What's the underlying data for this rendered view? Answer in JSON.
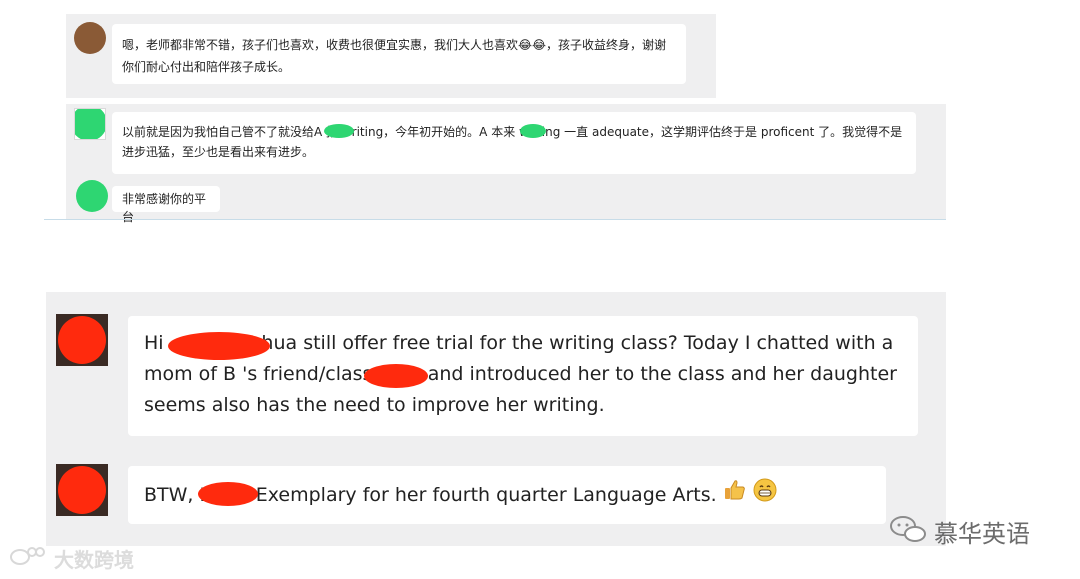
{
  "chat_section_1": {
    "messages": [
      {
        "avatar": "brown-user-avatar",
        "text": "嗯，老师都非常不错，孩子们也喜欢，收费也很便宜实惠，我们大人也喜欢😂😂，孩子收益终身，谢谢你们耐心付出和陪伴孩子成长。"
      }
    ]
  },
  "chat_section_2": {
    "messages": [
      {
        "avatar": "green-redacted-avatar",
        "text": "以前就是因为我怕自己管不了就没给A      报 writing，今年初开始的。A      本来 writing 一直 adequate，这学期评估终于是 proficent 了。我觉得不是进步迅猛，至少也是看出来有进步。"
      },
      {
        "avatar": "green-redacted-avatar",
        "text": "非常感谢你的平台"
      }
    ]
  },
  "chat_section_3": {
    "messages": [
      {
        "avatar": "red-redacted-avatar",
        "text": "Hi            , does Muhua still offer free trial for the writing class? Today I chatted with a mom of B      's friend/classmate and introduced her to the class and her daughter seems also has the need to improve her writing."
      },
      {
        "avatar": "red-redacted-avatar",
        "text": "BTW, B          got Exemplary for her fourth quarter Language Arts.",
        "emojis": [
          "thumbs-up-emoji",
          "grinning-emoji"
        ]
      }
    ]
  },
  "watermarks": {
    "left": "大数跨境",
    "right": "慕华英语"
  },
  "colors": {
    "panel_bg": "#efeff0",
    "redaction_green": "#2ed672",
    "redaction_red": "#ff2a0d",
    "accent_divider": "#c7dce8"
  }
}
